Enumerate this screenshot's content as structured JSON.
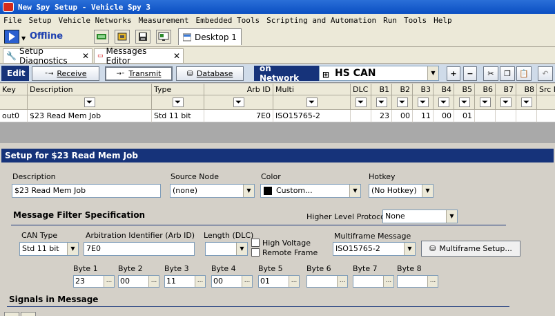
{
  "window": {
    "title": "New Spy Setup - Vehicle Spy 3"
  },
  "menu": [
    "File",
    "Setup",
    "Vehicle Networks",
    "Measurement",
    "Embedded Tools",
    "Scripting and Automation",
    "Run",
    "Tools",
    "Help"
  ],
  "toolbar": {
    "status": "Offline",
    "desktop_tab": "Desktop 1"
  },
  "tabs": [
    {
      "label": "Setup Diagnostics"
    },
    {
      "label": "Messages Editor"
    }
  ],
  "editbar": {
    "edit_label": "Edit",
    "receive": "Receive",
    "transmit": "Transmit",
    "database": "Database",
    "on_network_label": "on Network",
    "network": "HS CAN"
  },
  "grid": {
    "columns": [
      "Key",
      "Description",
      "Type",
      "Arb ID",
      "Multi",
      "DLC",
      "B1",
      "B2",
      "B3",
      "B4",
      "B5",
      "B6",
      "B7",
      "B8",
      "Src N"
    ],
    "row": {
      "key": "out0",
      "description": "$23 Read Mem Job",
      "type": "Std 11 bit",
      "arb_id": "7E0",
      "multi": "ISO15765-2",
      "b1": "23",
      "b2": "00",
      "b3": "11",
      "b4": "00",
      "b5": "01"
    }
  },
  "setup": {
    "title": "Setup for $23 Read Mem Job",
    "description_label": "Description",
    "description_value": "$23 Read Mem Job",
    "source_node_label": "Source Node",
    "source_node_value": "(none)",
    "color_label": "Color",
    "color_value": "Custom...",
    "hotkey_label": "Hotkey",
    "hotkey_value": "(No Hotkey)",
    "filter_title": "Message Filter Specification",
    "hlp_label": "Higher Level Protocol",
    "hlp_value": "None",
    "can_type_label": "CAN Type",
    "can_type_value": "Std 11 bit",
    "arb_label": "Arbitration Identifier (Arb ID)",
    "arb_value": "7E0",
    "length_label": "Length (DLC)",
    "high_voltage": "High Voltage",
    "remote_frame": "Remote Frame",
    "multiframe_label": "Multiframe Message",
    "multiframe_value": "ISO15765-2",
    "multiframe_setup": "Multiframe Setup...",
    "bytes": [
      {
        "label": "Byte 1",
        "value": "23"
      },
      {
        "label": "Byte 2",
        "value": "00"
      },
      {
        "label": "Byte 3",
        "value": "11"
      },
      {
        "label": "Byte 4",
        "value": "00"
      },
      {
        "label": "Byte 5",
        "value": "01"
      },
      {
        "label": "Byte 6",
        "value": ""
      },
      {
        "label": "Byte 7",
        "value": ""
      },
      {
        "label": "Byte 8",
        "value": ""
      }
    ],
    "signals_title": "Signals in Message"
  }
}
